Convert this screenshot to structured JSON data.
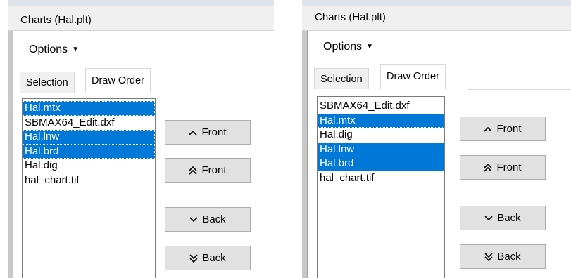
{
  "panels": [
    {
      "title": "Charts (Hal.plt)",
      "options_label": "Options",
      "tabs": [
        "Selection",
        "Draw Order"
      ],
      "active_tab": "Draw Order",
      "list": [
        {
          "label": "Hal.mtx",
          "selected": true,
          "focused": true
        },
        {
          "label": "SBMAX64_Edit.dxf",
          "selected": false
        },
        {
          "label": "Hal.lnw",
          "selected": true,
          "focused": true
        },
        {
          "label": "Hal.brd",
          "selected": true,
          "focused": true
        },
        {
          "label": "Hal.dig",
          "selected": false
        },
        {
          "label": "hal_chart.tif",
          "selected": false
        }
      ],
      "buttons": [
        {
          "label": "Front",
          "icon": "chevron-up-icon"
        },
        {
          "label": "Front",
          "icon": "double-chevron-up-icon"
        },
        {
          "label": "Back",
          "icon": "chevron-down-icon"
        },
        {
          "label": "Back",
          "icon": "double-chevron-down-icon"
        }
      ]
    },
    {
      "title": "Charts (Hal.plt)",
      "options_label": "Options",
      "tabs": [
        "Selection",
        "Draw Order"
      ],
      "active_tab": "Draw Order",
      "list": [
        {
          "label": "SBMAX64_Edit.dxf",
          "selected": false
        },
        {
          "label": "Hal.mtx",
          "selected": true,
          "focused": true
        },
        {
          "label": "Hal.dig",
          "selected": false
        },
        {
          "label": "Hal.lnw",
          "selected": true
        },
        {
          "label": "Hal.brd",
          "selected": true
        },
        {
          "label": "hal_chart.tif",
          "selected": false
        }
      ],
      "buttons": [
        {
          "label": "Front",
          "icon": "chevron-up-icon"
        },
        {
          "label": "Front",
          "icon": "double-chevron-up-icon"
        },
        {
          "label": "Back",
          "icon": "chevron-down-icon"
        },
        {
          "label": "Back",
          "icon": "double-chevron-down-icon"
        }
      ]
    }
  ],
  "colors": {
    "selection": "#0078d7",
    "panel_background": "#f0f0f0",
    "button_face": "#e1e1e1",
    "button_border": "#adadad"
  }
}
